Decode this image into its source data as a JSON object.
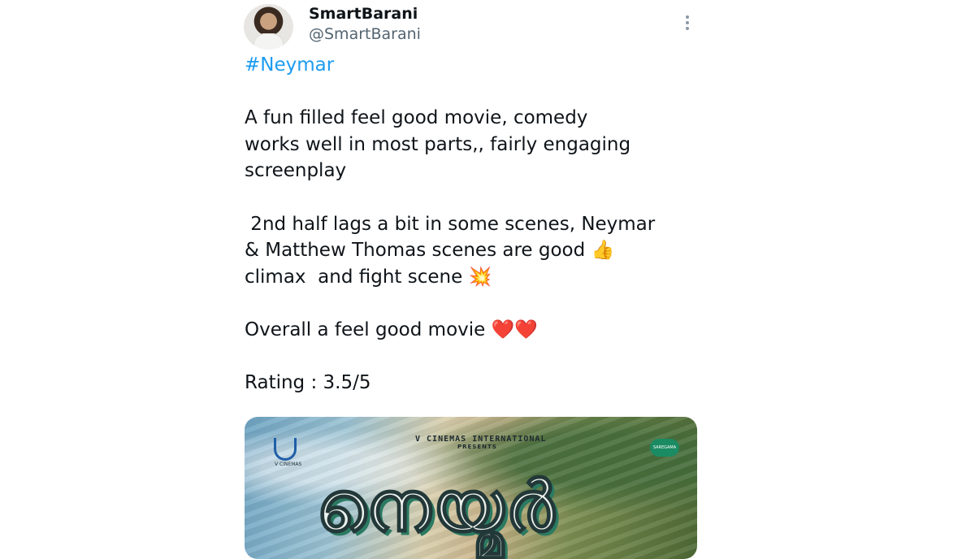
{
  "tweet": {
    "author_name": "SmartBarani",
    "author_handle": "@SmartBarani",
    "more_icon": "more-vertical-icon",
    "hashtag": "#Neymar",
    "paragraph1": [
      "A fun filled feel good movie, comedy",
      "works well in most parts,, fairly engaging",
      "screenplay"
    ],
    "paragraph2": [
      " 2nd half lags a bit in some scenes, Neymar",
      "& Matthew Thomas scenes are good 👍",
      "climax  and fight scene 💥"
    ],
    "paragraph3": "Overall a feel good movie ❤️❤️",
    "rating": "Rating : 3.5/5",
    "colors": {
      "link": "#1d9bf0",
      "text": "#0f1419",
      "secondary": "#536471"
    }
  },
  "media": {
    "studio": "V CINEMAS  INTERNATIONAL",
    "presents": "PRESENTS",
    "logo_text": "V CINEMAS",
    "music_logo": "SAREGAMA",
    "title": "നെയ്മർ"
  }
}
